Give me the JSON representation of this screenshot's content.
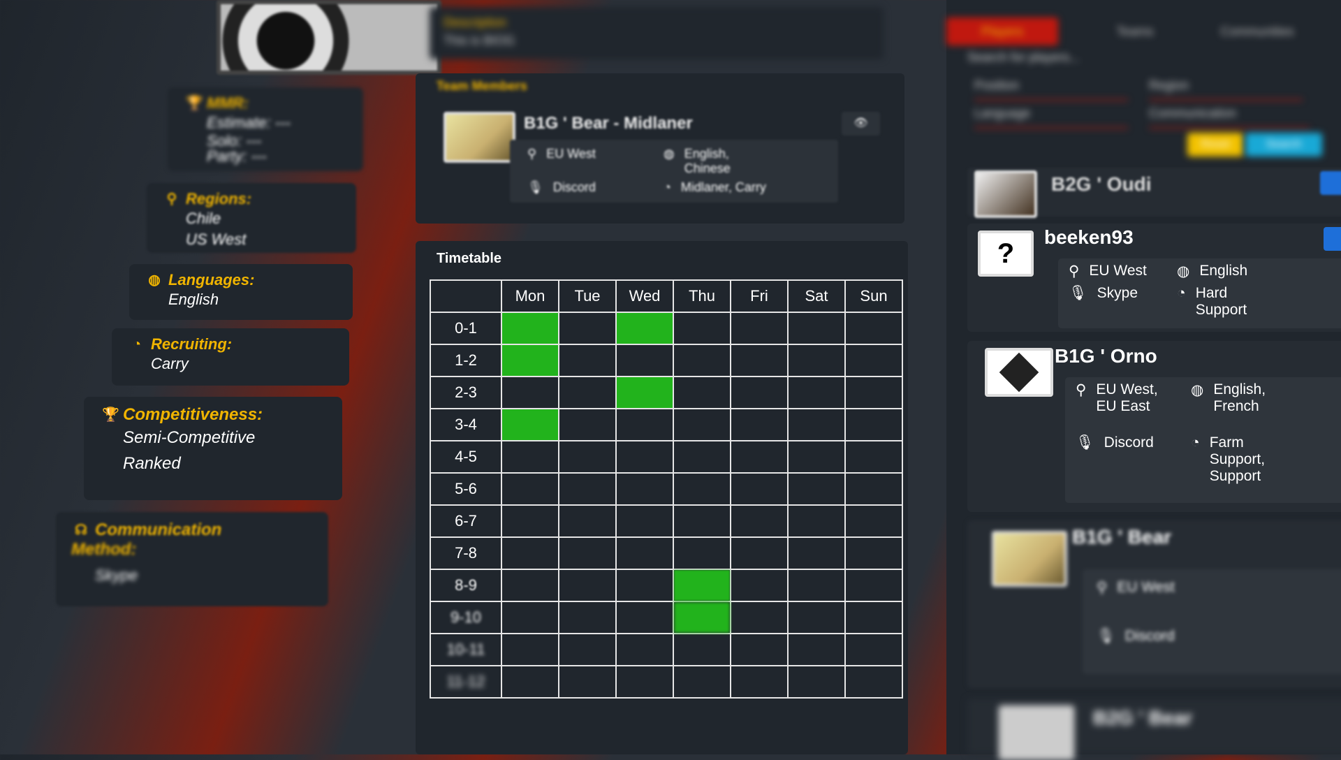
{
  "left": {
    "mmr": {
      "title": "MMR:",
      "lines": [
        "Estimate: ---",
        "Solo: ---",
        "Party: ---"
      ]
    },
    "regions": {
      "title": "Regions:",
      "values": [
        "Chile",
        "US West"
      ]
    },
    "languages": {
      "title": "Languages:",
      "values": [
        "English"
      ]
    },
    "recruiting": {
      "title": "Recruiting:",
      "values": [
        "Carry"
      ]
    },
    "competitiveness": {
      "title": "Competitiveness:",
      "values": [
        "Semi-Competitive",
        "Ranked"
      ]
    },
    "communication": {
      "title": "Communication",
      "title2": "Method:",
      "values": [
        "Skype"
      ]
    }
  },
  "center": {
    "description": {
      "label": "Description",
      "text": "This is BIOG"
    },
    "team_members": {
      "title": "Team Members",
      "member": {
        "name": "B1G ' Bear - Midlaner",
        "region": "EU West",
        "languages": "English, Chinese",
        "comm": "Discord",
        "roles": "Midlaner, Carry"
      }
    },
    "timetable": {
      "title": "Timetable",
      "days": [
        "Mon",
        "Tue",
        "Wed",
        "Thu",
        "Fri",
        "Sat",
        "Sun"
      ],
      "hours": [
        "0-1",
        "1-2",
        "2-3",
        "3-4",
        "4-5",
        "5-6",
        "6-7",
        "7-8",
        "8-9",
        "9-10",
        "10-11",
        "11-12"
      ],
      "active": [
        [
          0,
          0
        ],
        [
          0,
          2
        ],
        [
          1,
          0
        ],
        [
          2,
          2
        ],
        [
          3,
          0
        ],
        [
          8,
          3
        ],
        [
          9,
          3
        ]
      ]
    }
  },
  "right": {
    "tabs": [
      "Players",
      "Teams",
      "Communities"
    ],
    "search_placeholder": "Search for players...",
    "filters": [
      "Position",
      "Region",
      "Language",
      "Communication"
    ],
    "reset_label": "Reset",
    "search_label": "Search",
    "players": [
      {
        "name": "B2G ' Oudi"
      },
      {
        "name": "beeken93",
        "region": "EU West",
        "language": "English",
        "comm": "Skype",
        "roles": "Hard Support"
      },
      {
        "name": "B1G ' Orno",
        "region": "EU West, EU East",
        "language": "English, French",
        "comm": "Discord",
        "roles": "Farm Support, Support"
      },
      {
        "name": "B1G ' Bear",
        "region": "EU West",
        "comm": "Discord"
      },
      {
        "name": "B2G ' Bear"
      }
    ]
  },
  "colors": {
    "accent": "#f0b400",
    "active_cell": "#22b31c",
    "tab_active": "#c0180f",
    "reset": "#f2c200",
    "search": "#19a9d6"
  }
}
